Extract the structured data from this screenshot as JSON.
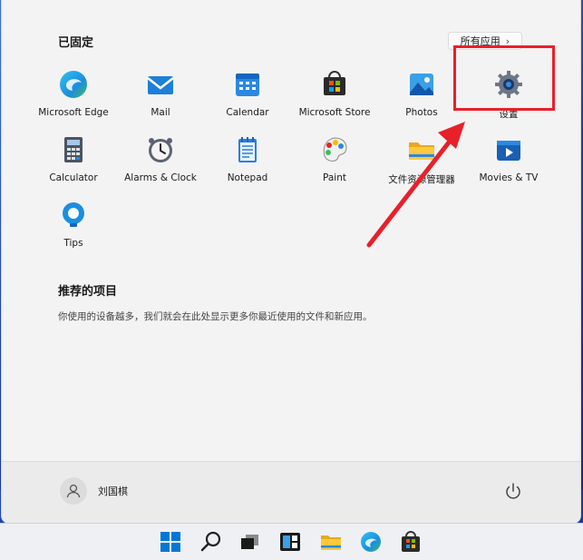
{
  "start_menu": {
    "pinned_title": "已固定",
    "all_apps_label": "所有应用",
    "pinned_apps": [
      {
        "label": "Microsoft Edge",
        "icon": "edge-icon"
      },
      {
        "label": "Mail",
        "icon": "mail-icon"
      },
      {
        "label": "Calendar",
        "icon": "calendar-icon"
      },
      {
        "label": "Microsoft Store",
        "icon": "store-icon"
      },
      {
        "label": "Photos",
        "icon": "photos-icon"
      },
      {
        "label": "设置",
        "icon": "gear-icon"
      },
      {
        "label": "Calculator",
        "icon": "calculator-icon"
      },
      {
        "label": "Alarms & Clock",
        "icon": "clock-icon"
      },
      {
        "label": "Notepad",
        "icon": "notepad-icon"
      },
      {
        "label": "Paint",
        "icon": "paint-icon"
      },
      {
        "label": "文件资源管理器",
        "icon": "folder-icon"
      },
      {
        "label": "Movies & TV",
        "icon": "movies-icon"
      },
      {
        "label": "Tips",
        "icon": "tips-icon"
      }
    ],
    "recommended_title": "推荐的项目",
    "recommended_text": "你使用的设备越多，我们就会在此处显示更多你最近使用的文件和新应用。",
    "user_name": "刘国棋"
  },
  "taskbar": {
    "icons": [
      "windows-start-icon",
      "search-icon",
      "task-view-icon",
      "widgets-icon",
      "file-explorer-icon",
      "edge-icon",
      "store-icon"
    ]
  },
  "colors": {
    "highlight": "#e8202a",
    "accent": "#0067c0"
  }
}
